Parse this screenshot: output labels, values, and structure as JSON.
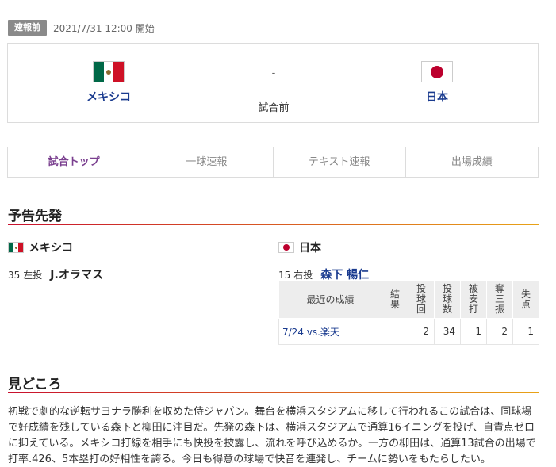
{
  "status": {
    "badge": "速報前",
    "datetime": "2021/7/31 12:00 開始"
  },
  "score": {
    "home_team": "メキシコ",
    "away_team": "日本",
    "score_text": "-",
    "state": "試合前"
  },
  "tabs": [
    {
      "label": "試合トップ",
      "active": true
    },
    {
      "label": "一球速報",
      "active": false
    },
    {
      "label": "テキスト速報",
      "active": false
    },
    {
      "label": "出場成績",
      "active": false
    }
  ],
  "starting": {
    "title": "予告先発",
    "home": {
      "team": "メキシコ",
      "number": "35",
      "position": "左投",
      "name": "J.オラマス"
    },
    "away": {
      "team": "日本",
      "number": "15",
      "position": "右投",
      "name": "森下 暢仁"
    }
  },
  "recent_stats": {
    "headers": [
      "最近の成績",
      "結果",
      "投球回",
      "投球数",
      "被安打",
      "奪三振",
      "失点"
    ],
    "rows": [
      {
        "game": "7/24 vs.楽天",
        "result": "",
        "innings": "2",
        "pitches": "34",
        "hits": "1",
        "strikeouts": "2",
        "runs": "1"
      }
    ]
  },
  "highlights": {
    "title": "見どころ",
    "text": "初戦で劇的な逆転サヨナラ勝利を収めた侍ジャパン。舞台を横浜スタジアムに移して行われるこの試合は、同球場で好成績を残している森下と柳田に注目だ。先発の森下は、横浜スタジアムで通算16イニングを投げ、自責点ゼロに抑えている。メキシコ打線を相手にも快投を披露し、流れを呼び込めるか。一方の柳田は、通算13試合の出場で打率.426、5本塁打の好相性を誇る。今日も得意の球場で快音を連発し、チームに勢いをもたらしたい。"
  },
  "colors": {
    "accent_purple": "#7a3f8f",
    "link_blue": "#1a3b8f",
    "line_red": "#c8102e",
    "line_orange": "#e8a317"
  },
  "icons": {
    "home_flag": "mexico-flag-icon",
    "away_flag": "japan-flag-icon"
  }
}
